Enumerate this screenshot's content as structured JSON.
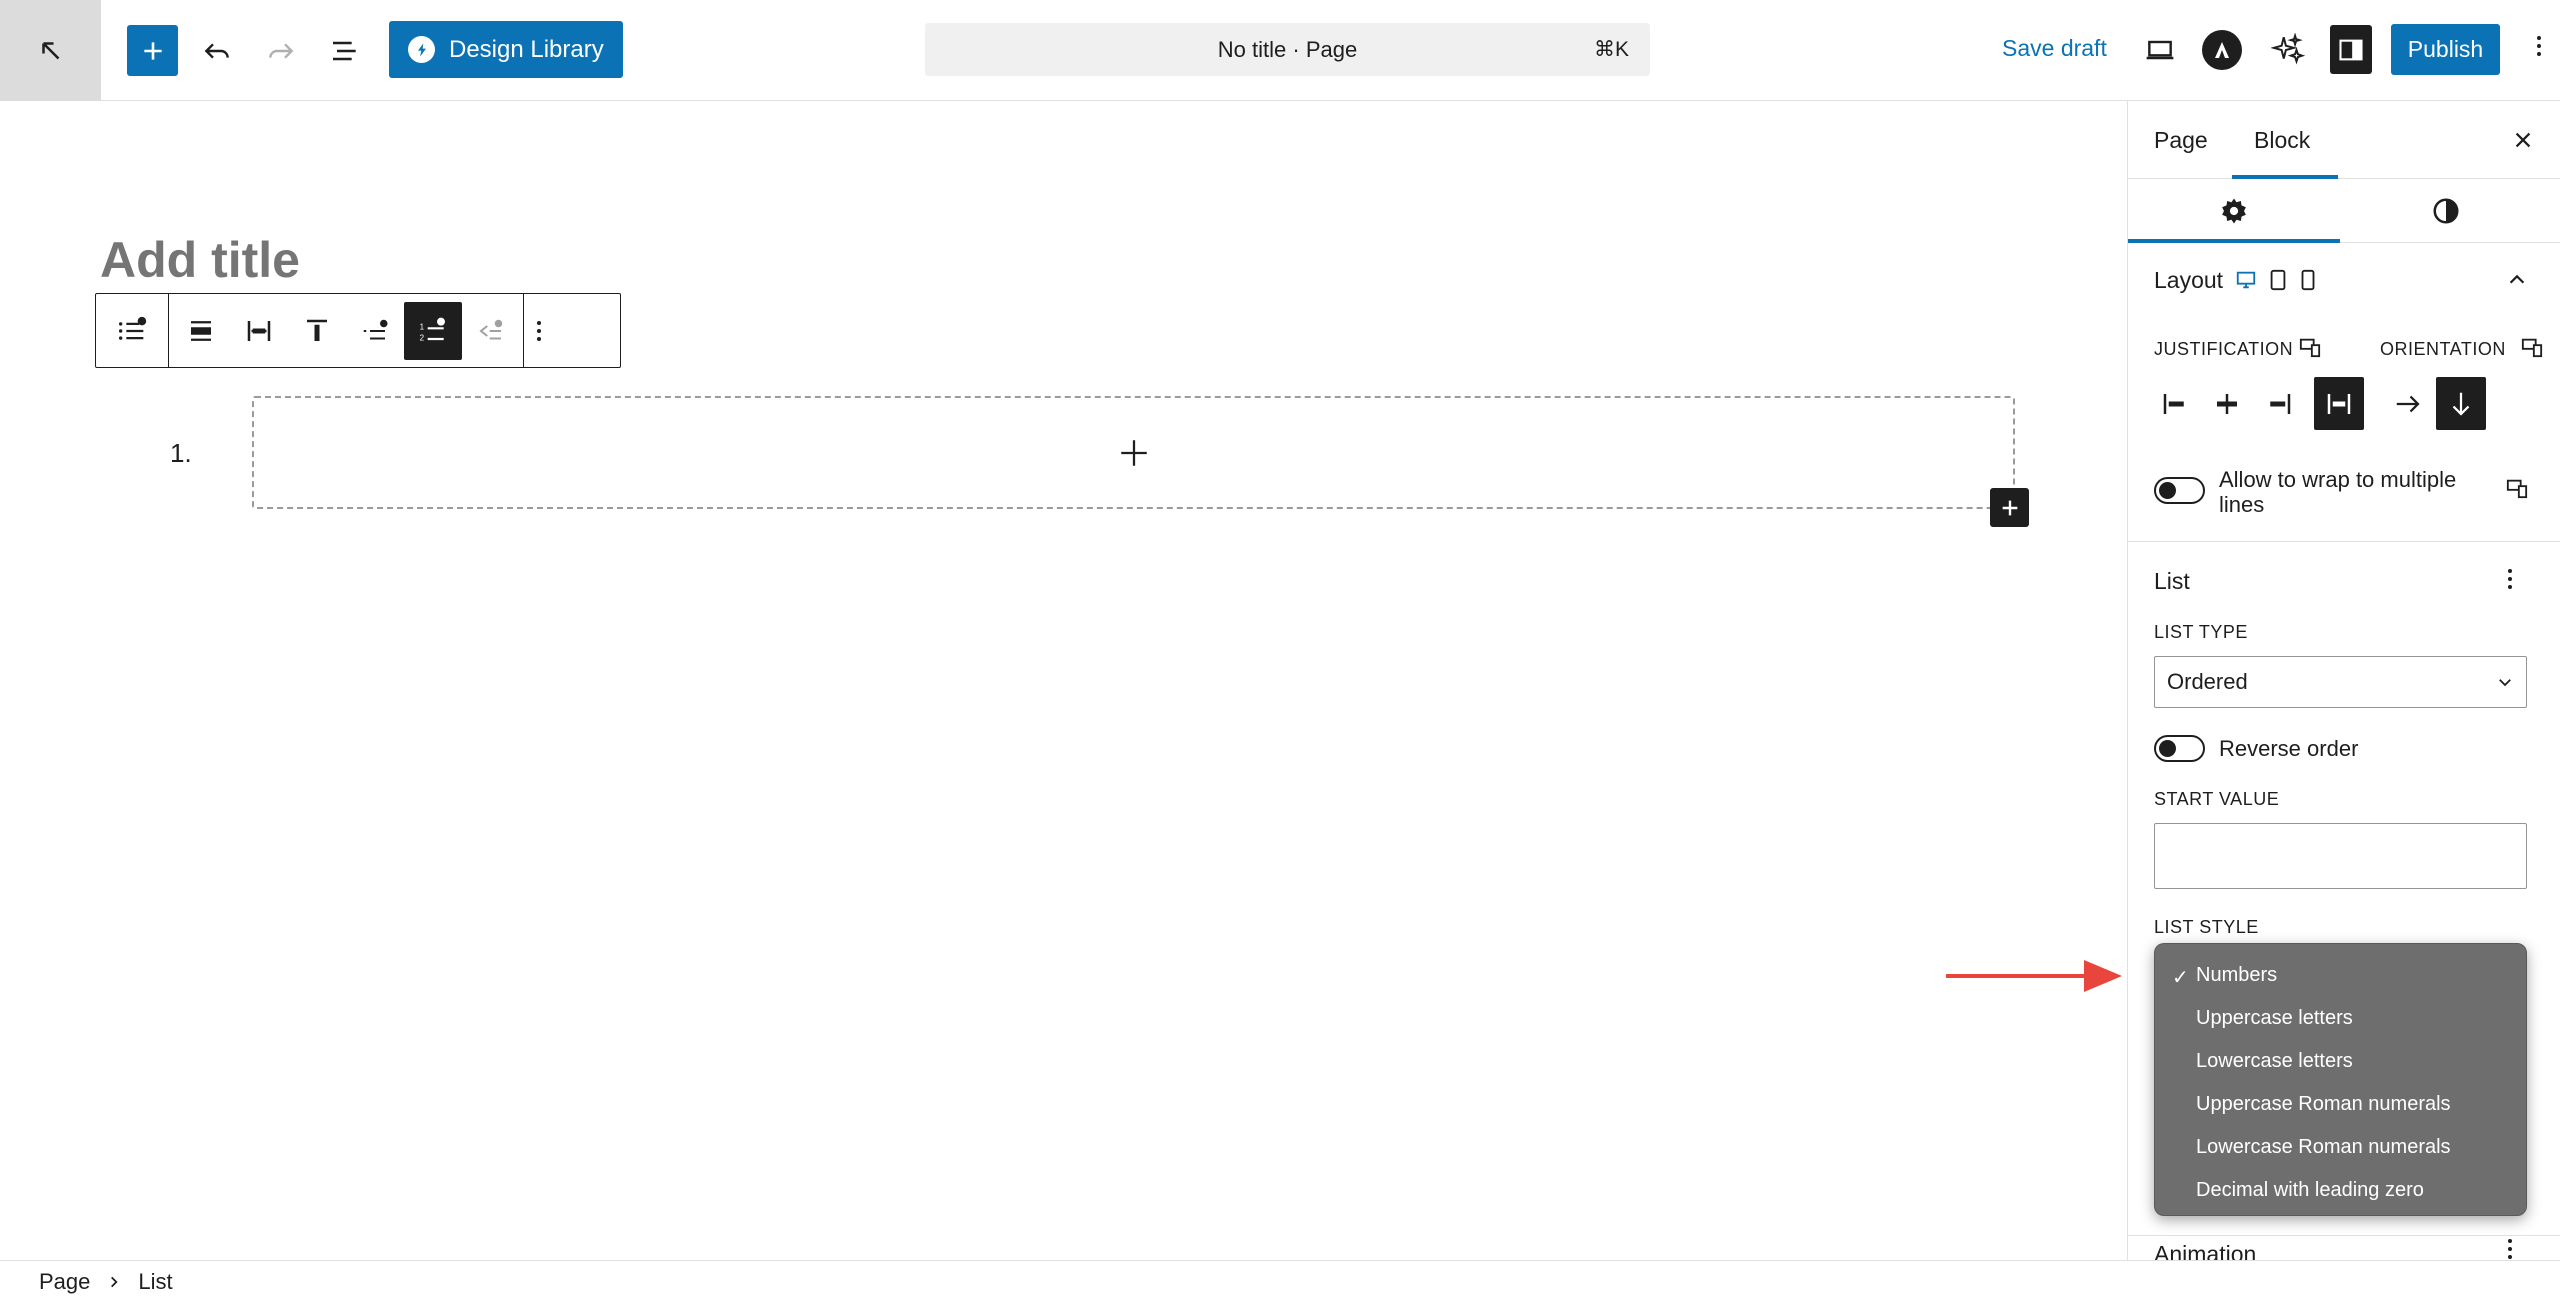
{
  "header": {
    "design_library_label": "Design Library",
    "command_bar_title": "No title · Page",
    "command_shortcut": "⌘K",
    "save_draft_label": "Save draft",
    "publish_label": "Publish"
  },
  "editor": {
    "title_placeholder": "Add title",
    "list_number": "1."
  },
  "sidebar": {
    "tabs": [
      {
        "label": "Page"
      },
      {
        "label": "Block"
      }
    ],
    "active_tab": "Block",
    "layout": {
      "title": "Layout",
      "justification_label": "JUSTIFICATION",
      "orientation_label": "ORIENTATION",
      "wrap_label_line1": "Allow to wrap to multiple",
      "wrap_label_line2": "lines"
    },
    "list": {
      "title": "List",
      "list_type_label": "LIST TYPE",
      "list_type_value": "Ordered",
      "reverse_order_label": "Reverse order",
      "start_value_label": "START VALUE",
      "start_value": "",
      "list_style_label": "LIST STYLE"
    },
    "animation_title": "Animation"
  },
  "list_style_dropdown": {
    "selected": "Numbers",
    "options": [
      {
        "label": "Numbers"
      },
      {
        "label": "Uppercase letters"
      },
      {
        "label": "Lowercase letters"
      },
      {
        "label": "Uppercase Roman numerals"
      },
      {
        "label": "Lowercase Roman numerals"
      },
      {
        "label": "Decimal with leading zero"
      }
    ]
  },
  "footer": {
    "breadcrumb": [
      {
        "label": "Page"
      },
      {
        "label": "List"
      }
    ]
  },
  "colors": {
    "accent": "#0a72b5",
    "annotation_arrow": "#e8453c",
    "dropdown_bg": "#6e6e6e"
  }
}
